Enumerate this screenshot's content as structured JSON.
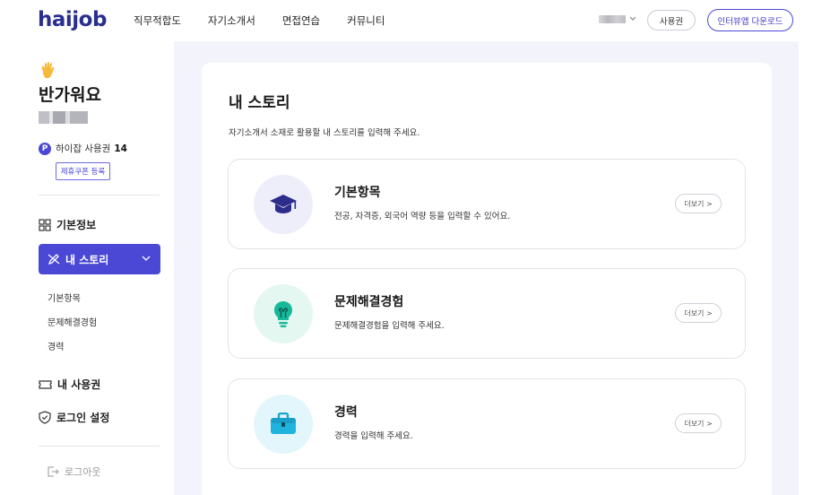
{
  "header": {
    "logo": "haijob",
    "nav": [
      "직무적합도",
      "자기소개서",
      "면접연습",
      "커뮤니티"
    ],
    "ticket_button": "사용권",
    "download_button": "인터뷰앱 다운로드"
  },
  "sidebar": {
    "greeting": "반가워요",
    "points_badge": "P",
    "points_label": "하이잡 사용권",
    "points_count": "14",
    "coupon_button": "제휴쿠폰 등록",
    "menu": {
      "basic_info": "기본정보",
      "my_story": "내 스토리",
      "my_tickets": "내 사용권",
      "login_settings": "로그인 설정",
      "logout": "로그아웃"
    },
    "story_submenu": [
      "기본항목",
      "문제해결경험",
      "경력"
    ]
  },
  "main": {
    "title": "내 스토리",
    "description": "자기소개서 소재로 활용할 내 스토리를 입력해 주세요.",
    "cards": [
      {
        "title": "기본항목",
        "description": "전공, 자격증, 외국어 역량 등을 입력할 수 있어요.",
        "more": "더보기 >",
        "icon": "graduation-cap-icon",
        "bg": "#eeeefb"
      },
      {
        "title": "문제해결경험",
        "description": "문제해결경험을 입력해 주세요.",
        "more": "더보기 >",
        "icon": "lightbulb-icon",
        "bg": "#e4f7f1"
      },
      {
        "title": "경력",
        "description": "경력을 입력해 주세요.",
        "more": "더보기 >",
        "icon": "briefcase-icon",
        "bg": "#e3f6fb"
      }
    ]
  },
  "colors": {
    "accent": "#4b48d6",
    "logo": "#2a2f8f",
    "page_bg": "#f3f4fb"
  }
}
